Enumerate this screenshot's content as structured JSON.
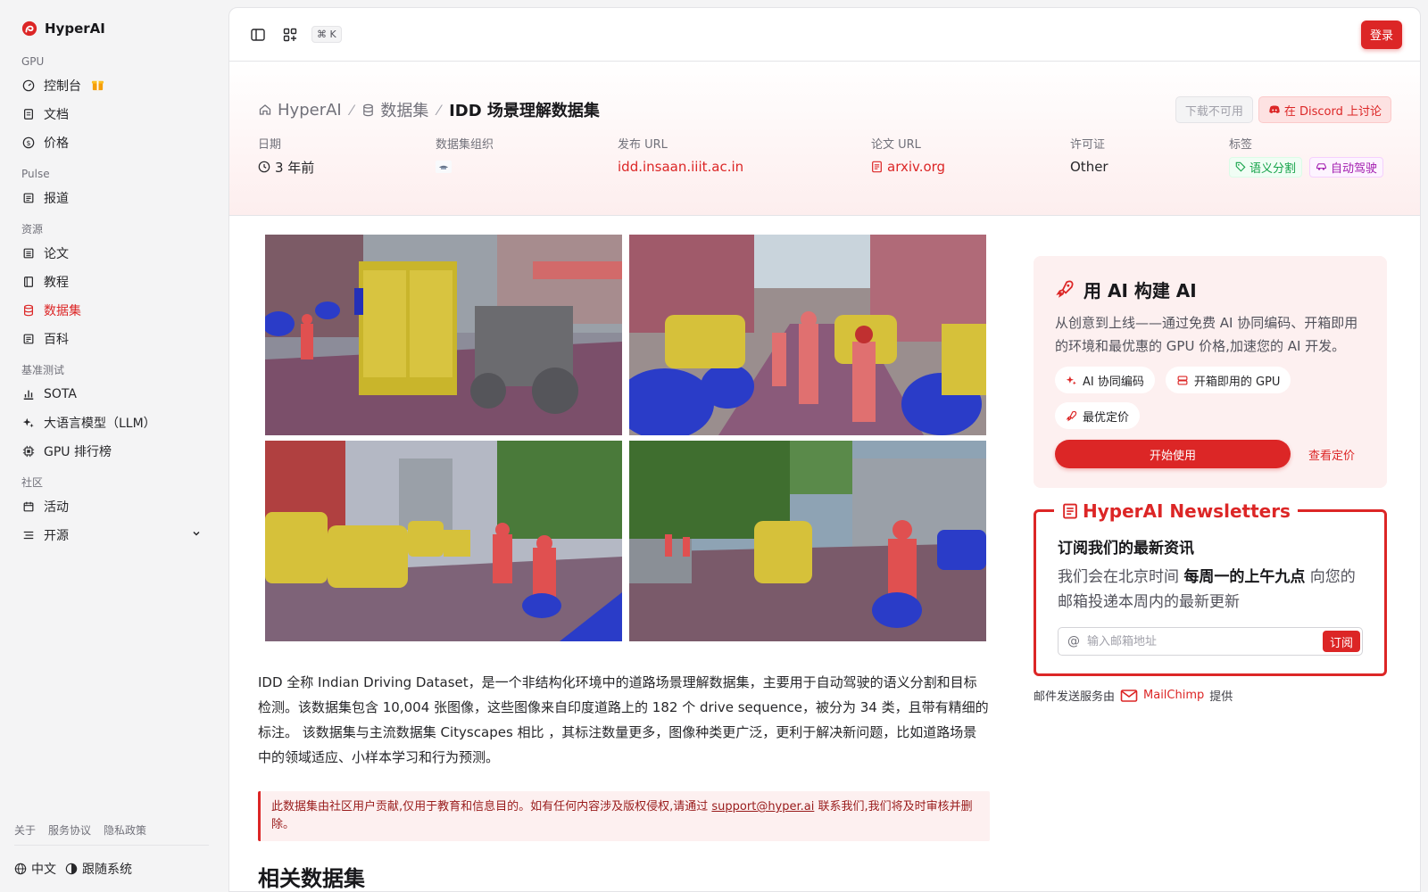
{
  "brand": {
    "name": "HyperAI"
  },
  "sidebar": {
    "sections": [
      {
        "title": "GPU",
        "items": [
          {
            "label": "控制台",
            "icon": "dashboard-icon"
          },
          {
            "label": "文档",
            "icon": "document-icon"
          },
          {
            "label": "价格",
            "icon": "dollar-icon"
          }
        ]
      },
      {
        "title": "Pulse",
        "items": [
          {
            "label": "报道",
            "icon": "news-icon"
          }
        ]
      },
      {
        "title": "资源",
        "items": [
          {
            "label": "论文",
            "icon": "paper-icon"
          },
          {
            "label": "教程",
            "icon": "book-icon"
          },
          {
            "label": "数据集",
            "icon": "database-icon",
            "active": true
          },
          {
            "label": "百科",
            "icon": "encyclopedia-icon"
          }
        ]
      },
      {
        "title": "基准测试",
        "items": [
          {
            "label": "SOTA",
            "icon": "chart-icon"
          },
          {
            "label": "大语言模型（LLM）",
            "icon": "sparkles-icon"
          },
          {
            "label": "GPU 排行榜",
            "icon": "chip-icon"
          }
        ]
      },
      {
        "title": "社区",
        "items": [
          {
            "label": "活动",
            "icon": "calendar-icon"
          },
          {
            "label": "开源",
            "icon": "list-icon"
          }
        ]
      }
    ],
    "footer": {
      "about": "关于",
      "terms": "服务协议",
      "privacy": "隐私政策",
      "language": "中文",
      "theme": "跟随系统"
    }
  },
  "topbar": {
    "shortcut": "⌘ K",
    "login": "登录"
  },
  "breadcrumb": {
    "home": "HyperAI",
    "section": "数据集",
    "current": "IDD 场景理解数据集"
  },
  "header_actions": {
    "download": "下载不可用",
    "discord": "在 Discord 上讨论"
  },
  "meta": {
    "date_label": "日期",
    "date_value": "3 年前",
    "org_label": "数据集组织",
    "url_label": "发布 URL",
    "url_value": "idd.insaan.iiit.ac.in",
    "paper_label": "论文 URL",
    "paper_value": "arxiv.org",
    "license_label": "许可证",
    "license_value": "Other",
    "tags_label": "标签",
    "tag1": "语义分割",
    "tag2": "自动驾驶"
  },
  "content": {
    "description": "IDD 全称 Indian Driving Dataset，是一个非结构化环境中的道路场景理解数据集，主要用于自动驾驶的语义分割和目标检测。该数据集包含 10,004 张图像，这些图像来自印度道路上的 182 个 drive sequence，被分为 34 类，且带有精细的标注。 该数据集与主流数据集 Cityscapes 相比 ，其标注数量更多，图像种类更广泛，更利于解决新问题，比如道路场景中的领域适应、小样本学习和行为预测。",
    "notice_prefix": "此数据集由社区用户贡献,仅用于教育和信息目的。如有任何内容涉及版权侵权,请通过 ",
    "notice_email": "support@hyper.ai",
    "notice_suffix": " 联系我们,我们将及时审核并删除。",
    "related_title": "相关数据集"
  },
  "promo": {
    "title": "用 AI 构建 AI",
    "description": "从创意到上线——通过免费 AI 协同编码、开箱即用的环境和最优惠的 GPU 价格,加速您的 AI 开发。",
    "chip1": "AI 协同编码",
    "chip2": "开箱即用的 GPU",
    "chip3": "最优定价",
    "start": "开始使用",
    "pricing": "查看定价"
  },
  "newsletter": {
    "legend": "HyperAI Newsletters",
    "heading": "订阅我们的最新资讯",
    "text_prefix": "我们会在北京时间 ",
    "text_bold": "每周一的上午九点",
    "text_suffix": " 向您的邮箱投递本周内的最新更新",
    "placeholder": "输入邮箱地址",
    "subscribe": "订阅",
    "mail_prefix": "邮件发送服务由",
    "mail_brand": "MailChimp",
    "mail_suffix": "提供"
  },
  "colors": {
    "accent": "#dc2626",
    "promo_bg": "#fdf0f0"
  }
}
